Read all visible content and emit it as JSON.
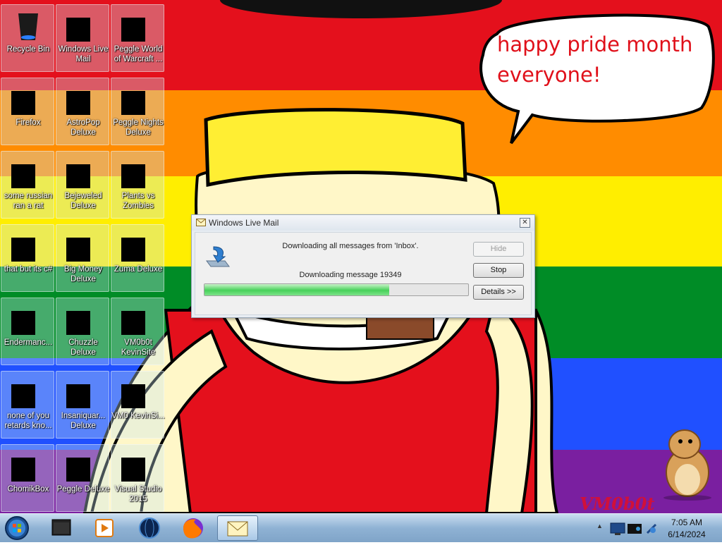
{
  "desktop": {
    "icons": [
      {
        "label": "Recycle Bin",
        "icon": "recycle-bin-icon"
      },
      {
        "label": "Windows Live Mail",
        "icon": "mail-icon"
      },
      {
        "label": "Peggle World of Warcraft ...",
        "icon": "peggle-icon"
      },
      {
        "label": "Firefox",
        "icon": "firefox-icon"
      },
      {
        "label": "AstroPop Deluxe",
        "icon": "astropop-icon"
      },
      {
        "label": "Peggle Nights Deluxe",
        "icon": "peggle-nights-icon"
      },
      {
        "label": "some russian ran a rat",
        "icon": "shortcut-icon"
      },
      {
        "label": "Bejeweled Deluxe",
        "icon": "bejeweled-icon"
      },
      {
        "label": "Plants vs Zombies",
        "icon": "plants-vs-zombies-icon"
      },
      {
        "label": "that but its c#",
        "icon": "shortcut-icon"
      },
      {
        "label": "Big Money Deluxe",
        "icon": "big-money-icon"
      },
      {
        "label": "Zuma Deluxe",
        "icon": "zuma-icon"
      },
      {
        "label": "Endermanc...",
        "icon": "window-icon"
      },
      {
        "label": "Chuzzle Deluxe",
        "icon": "chuzzle-icon"
      },
      {
        "label": "VM0b0t KevinSite",
        "icon": "website-icon"
      },
      {
        "label": "none of you retards kno...",
        "icon": "shortcut-icon"
      },
      {
        "label": "Insaniquar... Deluxe",
        "icon": "insaniquarium-icon"
      },
      {
        "label": "VM0 KevinSi...",
        "icon": "document-icon"
      },
      {
        "label": "ChomikBox",
        "icon": "chomikbox-icon"
      },
      {
        "label": "Peggle Deluxe",
        "icon": "peggle-deluxe-icon"
      },
      {
        "label": "Visual Studio 2015",
        "icon": "visual-studio-icon"
      }
    ]
  },
  "wallpaper": {
    "speech_bubble": {
      "line1": "happy pride month",
      "line2": "everyone!"
    },
    "signature": "VM0b0t",
    "stripe_colors": [
      "#e4101c",
      "#ff8c00",
      "#ffee00",
      "#008c26",
      "#2050ff",
      "#7a1fa0"
    ]
  },
  "dialog": {
    "title": "Windows Live Mail",
    "status_line": "Downloading all messages from 'Inbox'.",
    "progress_line": "Downloading message 19349",
    "progress_fraction": 0.7,
    "buttons": {
      "hide": "Hide",
      "stop": "Stop",
      "details": "Details >>"
    },
    "close_glyph": "✕"
  },
  "taskbar": {
    "start": "start-orb-icon",
    "pinned": [
      "window-icon",
      "media-player-icon",
      "globe-icon",
      "firefox-icon",
      "mail-icon"
    ],
    "tray_arrow": "▲",
    "clock": {
      "time": "7:05 AM",
      "date": "6/14/2024"
    }
  }
}
